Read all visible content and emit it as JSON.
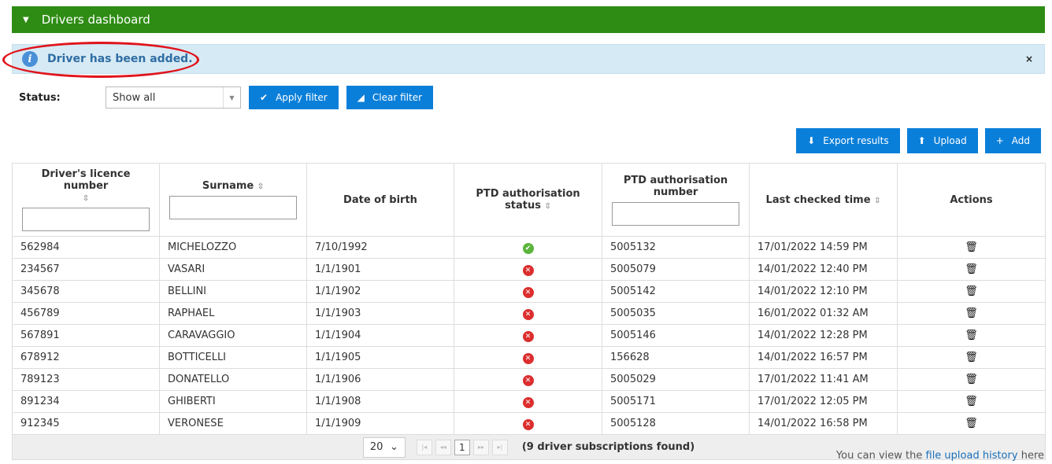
{
  "header": {
    "title": "Drivers dashboard"
  },
  "alert": {
    "message": "Driver has been added.",
    "close": "×"
  },
  "filter": {
    "label": "Status:",
    "selected": "Show all",
    "apply_label": "Apply filter",
    "clear_label": "Clear filter"
  },
  "toolbar": {
    "export_label": "Export results",
    "upload_label": "Upload",
    "add_label": "Add"
  },
  "table": {
    "headers": {
      "licence": "Driver's licence number",
      "surname": "Surname",
      "dob": "Date of birth",
      "ptd_status": "PTD authorisation status",
      "ptd_number": "PTD authorisation number",
      "last_checked": "Last checked time",
      "actions": "Actions"
    },
    "rows": [
      {
        "licence": "562984",
        "surname": "MICHELOZZO",
        "dob": "7/10/1992",
        "status": "ok",
        "ptd_number": "5005132",
        "last_checked": "17/01/2022 14:59 PM"
      },
      {
        "licence": "234567",
        "surname": "VASARI",
        "dob": "1/1/1901",
        "status": "bad",
        "ptd_number": "5005079",
        "last_checked": "14/01/2022 12:40 PM"
      },
      {
        "licence": "345678",
        "surname": "BELLINI",
        "dob": "1/1/1902",
        "status": "bad",
        "ptd_number": "5005142",
        "last_checked": "14/01/2022 12:10 PM"
      },
      {
        "licence": "456789",
        "surname": "RAPHAEL",
        "dob": "1/1/1903",
        "status": "bad",
        "ptd_number": "5005035",
        "last_checked": "16/01/2022 01:32 AM"
      },
      {
        "licence": "567891",
        "surname": "CARAVAGGIO",
        "dob": "1/1/1904",
        "status": "bad",
        "ptd_number": "5005146",
        "last_checked": "14/01/2022 12:28 PM"
      },
      {
        "licence": "678912",
        "surname": "BOTTICELLI",
        "dob": "1/1/1905",
        "status": "bad",
        "ptd_number": "156628",
        "last_checked": "14/01/2022 16:57 PM"
      },
      {
        "licence": "789123",
        "surname": "DONATELLO",
        "dob": "1/1/1906",
        "status": "bad",
        "ptd_number": "5005029",
        "last_checked": "17/01/2022 11:41 AM"
      },
      {
        "licence": "891234",
        "surname": "GHIBERTI",
        "dob": "1/1/1908",
        "status": "bad",
        "ptd_number": "5005171",
        "last_checked": "17/01/2022 12:05 PM"
      },
      {
        "licence": "912345",
        "surname": "VERONESE",
        "dob": "1/1/1909",
        "status": "bad",
        "ptd_number": "5005128",
        "last_checked": "14/01/2022 16:58 PM"
      }
    ]
  },
  "pager": {
    "page_size": "20",
    "current_page": "1",
    "found_text": "(9 driver subscriptions found)"
  },
  "footer": {
    "prefix": "You can view the",
    "link": "file upload history",
    "suffix": "here"
  },
  "colors": {
    "header_green": "#2e8c14",
    "button_blue": "#0a7fd9",
    "alert_bg": "#d6eaf5",
    "highlight_red": "#e0141b"
  }
}
